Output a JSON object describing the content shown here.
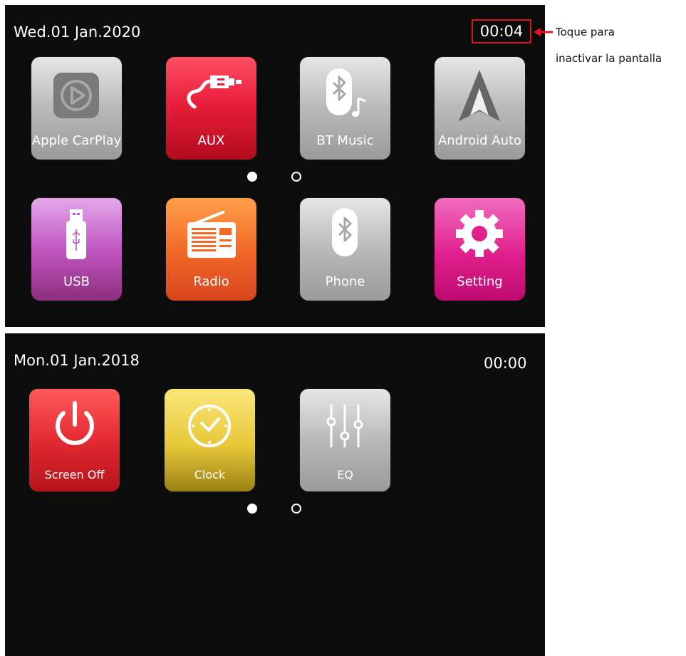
{
  "screen1": {
    "date": "Wed.01 Jan.2020",
    "time": "00:04",
    "apps": [
      {
        "label": "Apple CarPlay",
        "icon": "carplay-icon"
      },
      {
        "label": "AUX",
        "icon": "aux-cable-icon"
      },
      {
        "label": "BT Music",
        "icon": "bluetooth-music-icon"
      },
      {
        "label": "Android Auto",
        "icon": "android-auto-icon"
      },
      {
        "label": "USB",
        "icon": "usb-icon"
      },
      {
        "label": "Radio",
        "icon": "radio-icon"
      },
      {
        "label": "Phone",
        "icon": "bluetooth-icon"
      },
      {
        "label": "Setting",
        "icon": "gear-icon"
      }
    ],
    "page_indicator": {
      "current": 1,
      "total": 2
    }
  },
  "screen2": {
    "date": "Mon.01 Jan.2018",
    "time": "00:00",
    "apps": [
      {
        "label": "Screen Off",
        "icon": "power-icon"
      },
      {
        "label": "Clock",
        "icon": "clock-icon"
      },
      {
        "label": "EQ",
        "icon": "equalizer-icon"
      }
    ],
    "page_indicator": {
      "current": 1,
      "total": 2
    }
  },
  "annotation": {
    "line1": "Toque para",
    "line2": "inactivar la pantalla",
    "color": "#e0141b"
  }
}
